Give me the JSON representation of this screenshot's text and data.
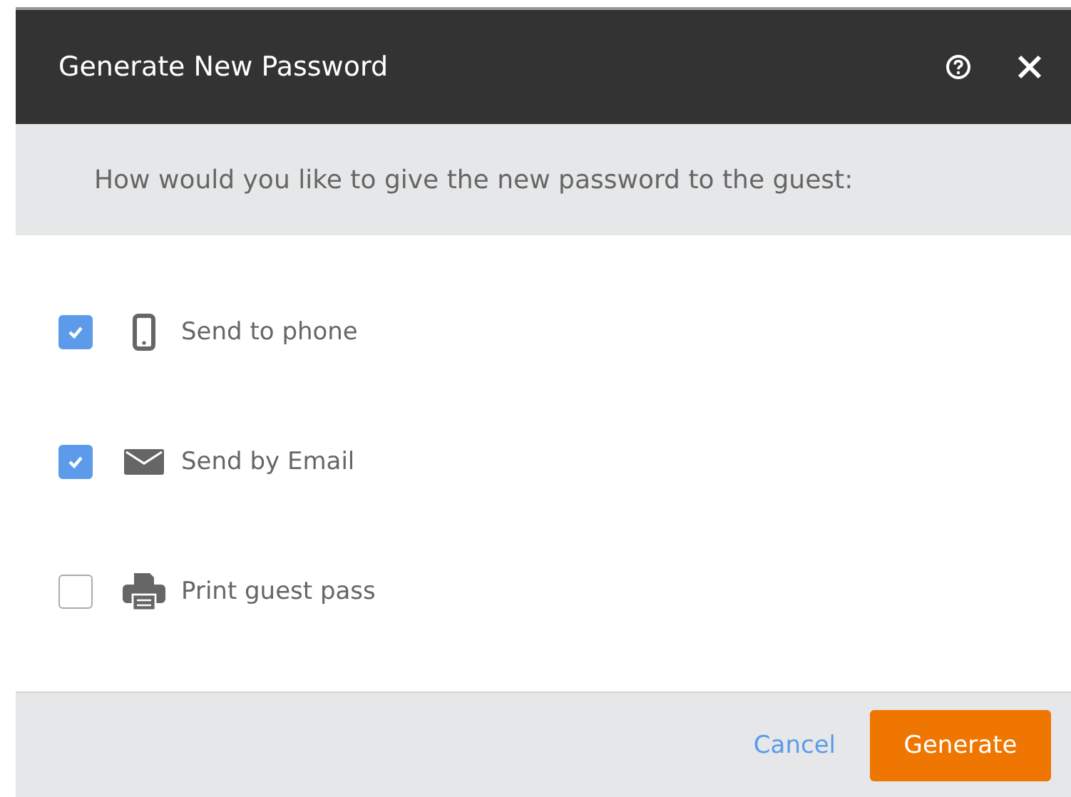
{
  "dialog": {
    "title": "Generate New Password",
    "prompt": "How would you like to give the new password to the guest:"
  },
  "options": [
    {
      "label": "Send to phone",
      "checked": true
    },
    {
      "label": "Send by Email",
      "checked": true
    },
    {
      "label": "Print guest pass",
      "checked": false
    }
  ],
  "buttons": {
    "cancel": "Cancel",
    "generate": "Generate"
  }
}
